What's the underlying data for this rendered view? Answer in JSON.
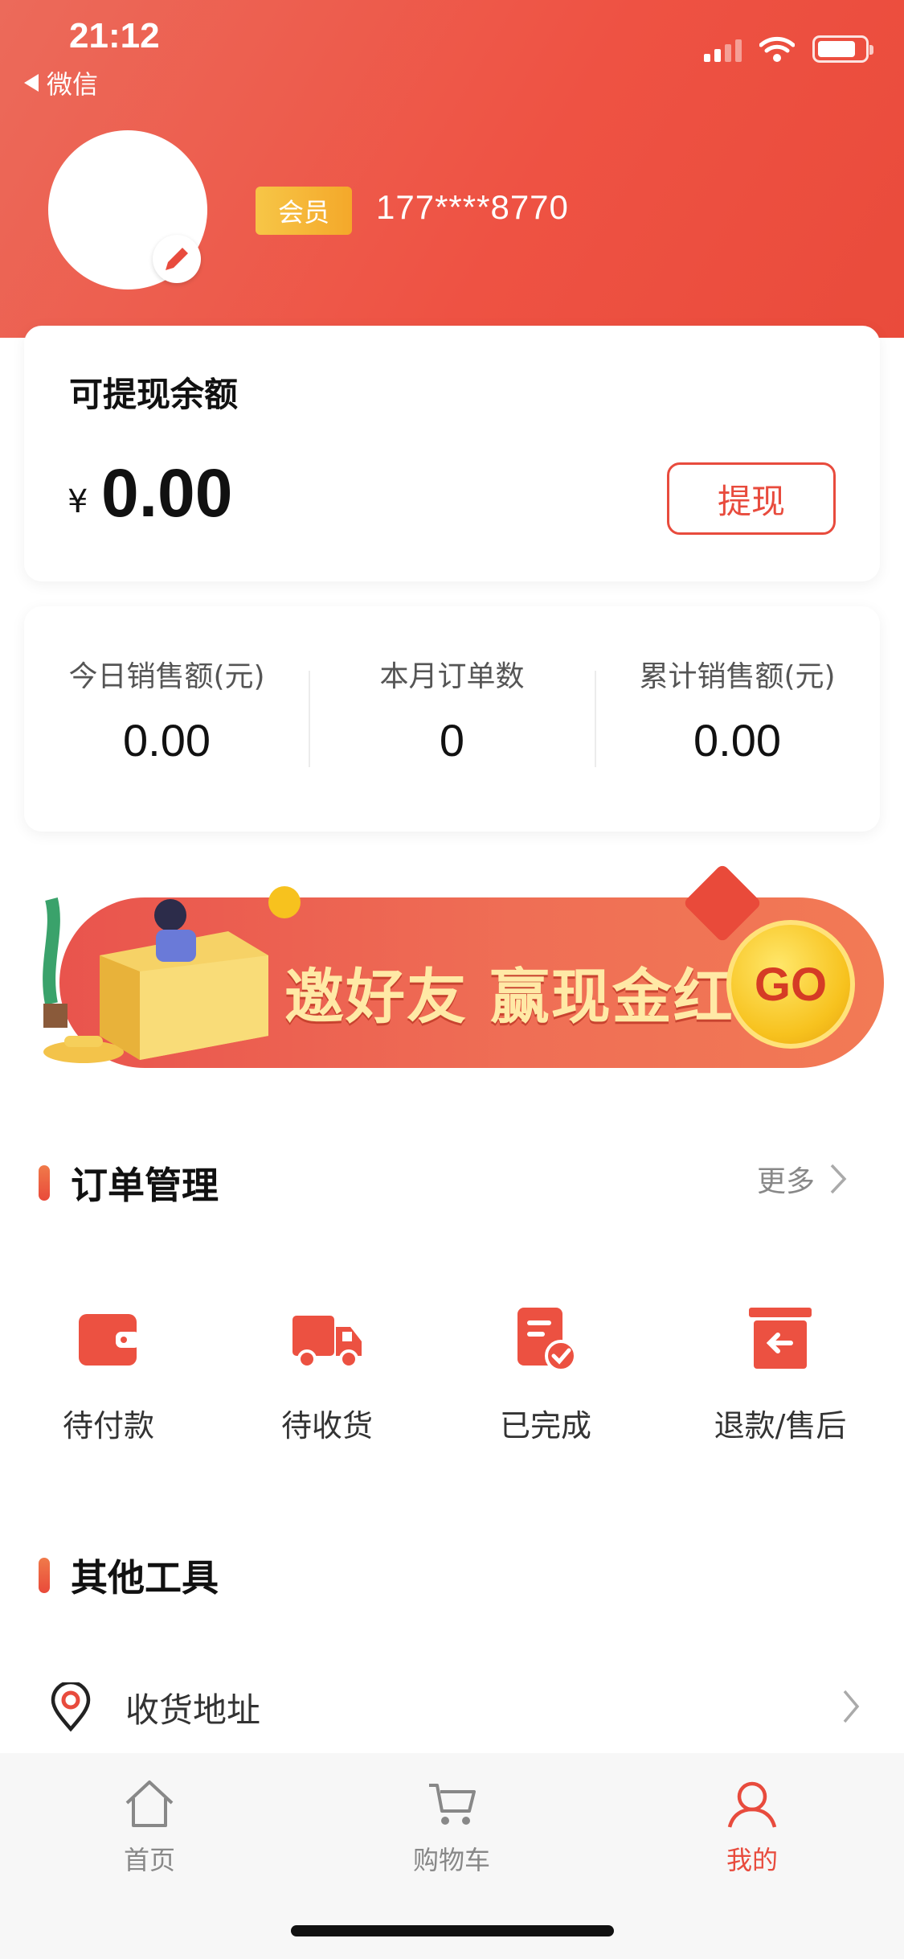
{
  "status_bar": {
    "time": "21:12",
    "back_label": "微信"
  },
  "profile": {
    "member_tag": "会员",
    "phone": "177****8770"
  },
  "balance": {
    "title": "可提现余额",
    "currency": "¥",
    "amount": "0.00",
    "withdraw_label": "提现"
  },
  "stats": [
    {
      "label": "今日销售额(元)",
      "value": "0.00"
    },
    {
      "label": "本月订单数",
      "value": "0"
    },
    {
      "label": "累计销售额(元)",
      "value": "0.00"
    }
  ],
  "banner": {
    "text": "邀好友 赢现金红包",
    "go_label": "GO"
  },
  "orders": {
    "title": "订单管理",
    "more_label": "更多",
    "items": [
      {
        "label": "待付款",
        "icon": "wallet-icon"
      },
      {
        "label": "待收货",
        "icon": "truck-icon"
      },
      {
        "label": "已完成",
        "icon": "completed-doc-icon"
      },
      {
        "label": "退款/售后",
        "icon": "refund-box-icon"
      }
    ]
  },
  "tools": {
    "title": "其他工具",
    "items": [
      {
        "label": "收货地址",
        "icon": "location-pin-icon"
      }
    ]
  },
  "tabbar": {
    "items": [
      {
        "label": "首页",
        "icon": "home-icon",
        "active": false
      },
      {
        "label": "购物车",
        "icon": "cart-icon",
        "active": false
      },
      {
        "label": "我的",
        "icon": "user-icon",
        "active": true
      }
    ]
  },
  "colors": {
    "accent": "#e84b3d",
    "header": "#ee5243",
    "member_tag": "#f4a82a"
  }
}
